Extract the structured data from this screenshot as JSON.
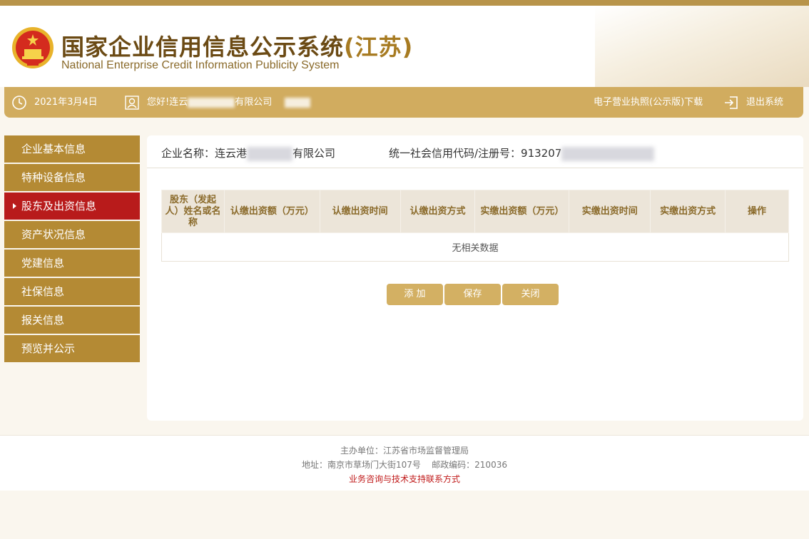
{
  "header": {
    "title_cn": "国家企业信用信息公示系统",
    "title_province": "(江苏)",
    "title_en": "National Enterprise Credit Information Publicity System"
  },
  "navbar": {
    "date": "2021年3月4日",
    "greeting_prefix": "您好!连云",
    "greeting_suffix": "有限公司",
    "license_download": "电子营业执照(公示版)下载",
    "logout": "退出系统"
  },
  "sidebar": {
    "items": [
      {
        "label": "企业基本信息"
      },
      {
        "label": "特种设备信息"
      },
      {
        "label": "股东及出资信息",
        "active": true
      },
      {
        "label": "资产状况信息"
      },
      {
        "label": "党建信息"
      },
      {
        "label": "社保信息"
      },
      {
        "label": "报关信息"
      },
      {
        "label": "预览并公示"
      }
    ]
  },
  "main": {
    "company_label": "企业名称：连云港",
    "company_suffix": "有限公司",
    "credit_label": "统一社会信用代码/注册号：913207",
    "table": {
      "headers": [
        "股东（发起人）姓名或名称",
        "认缴出资额（万元）",
        "认缴出资时间",
        "认缴出资方式",
        "实缴出资额（万元）",
        "实缴出资时间",
        "实缴出资方式",
        "操作"
      ],
      "empty_text": "无相关数据"
    },
    "buttons": {
      "add": "添 加",
      "save": "保存",
      "close": "关闭"
    }
  },
  "footer": {
    "sponsor": "主办单位：江苏省市场监督管理局",
    "address": "地址：南京市草场门大街107号    邮政编码：210036",
    "contact": "业务咨询与技术支持联系方式"
  },
  "colors": {
    "gold": "#d1ac5f",
    "sidebar": "#b48a34",
    "active": "#b81b1b",
    "button": "#d3b063"
  }
}
